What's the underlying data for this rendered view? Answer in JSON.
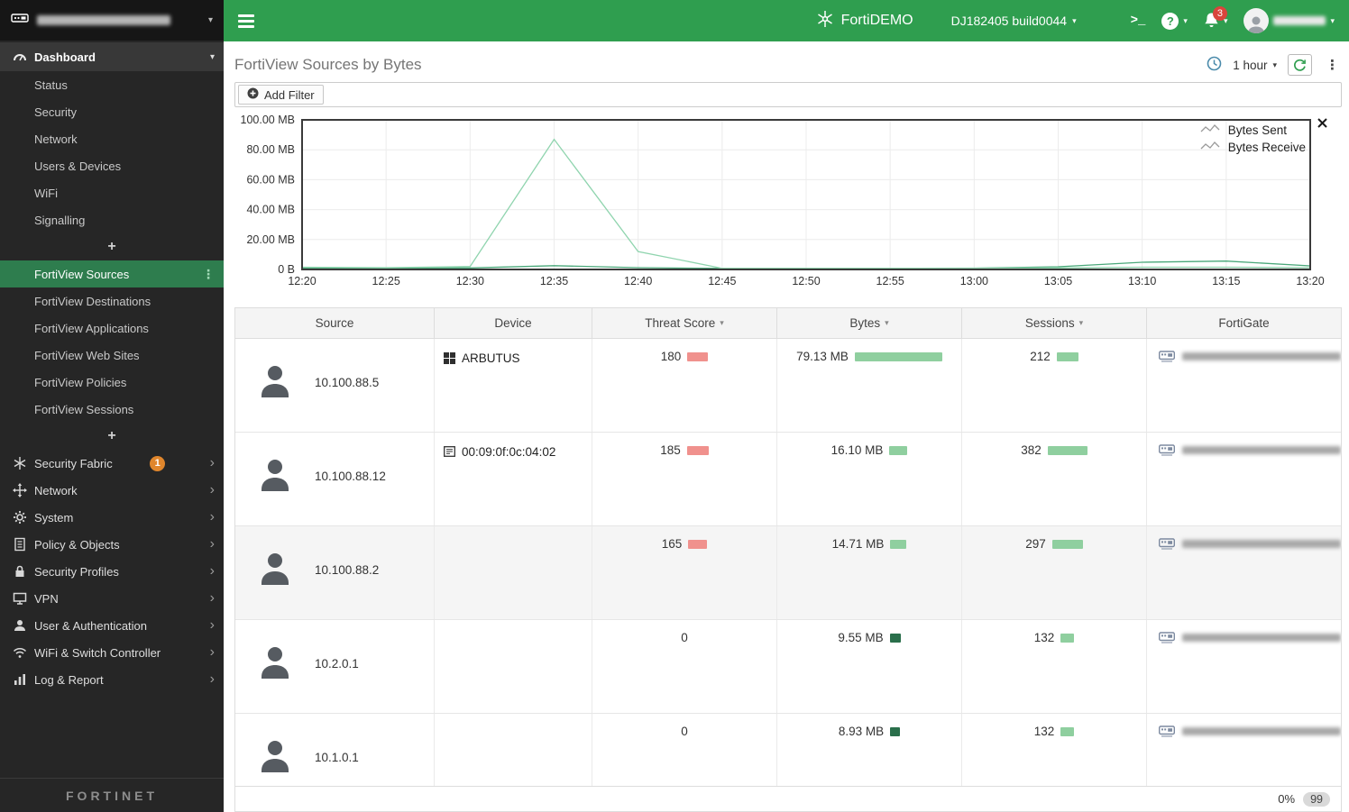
{
  "topbar": {
    "brand": "FortiDEMO",
    "build_label": "DJ182405 build0044",
    "cli_label": ">_",
    "help_label": "?",
    "notification_count": "3"
  },
  "sidebar": {
    "dashboard": {
      "label": "Dashboard"
    },
    "dashboard_items": [
      "Status",
      "Security",
      "Network",
      "Users & Devices",
      "WiFi",
      "Signalling"
    ],
    "add_button": "+",
    "fortiview_items": [
      {
        "label": "FortiView Sources",
        "selected": true
      },
      {
        "label": "FortiView Destinations"
      },
      {
        "label": "FortiView Applications"
      },
      {
        "label": "FortiView Web Sites"
      },
      {
        "label": "FortiView Policies"
      },
      {
        "label": "FortiView Sessions"
      }
    ],
    "add_button2": "+",
    "groups": [
      {
        "label": "Security Fabric",
        "icon": "fabric-icon",
        "badge": "1"
      },
      {
        "label": "Network",
        "icon": "network-icon"
      },
      {
        "label": "System",
        "icon": "gear-icon"
      },
      {
        "label": "Policy & Objects",
        "icon": "policy-icon"
      },
      {
        "label": "Security Profiles",
        "icon": "lock-icon"
      },
      {
        "label": "VPN",
        "icon": "monitor-icon"
      },
      {
        "label": "User & Authentication",
        "icon": "user-icon"
      },
      {
        "label": "WiFi & Switch Controller",
        "icon": "wifi-icon"
      },
      {
        "label": "Log & Report",
        "icon": "report-icon"
      }
    ],
    "logo_text": "FORTINET"
  },
  "main": {
    "title": "FortiView Sources by Bytes",
    "time_range": "1 hour",
    "filter_button": "Add Filter",
    "footer": {
      "percent": "0%",
      "count": "99"
    }
  },
  "chart_data": {
    "type": "line",
    "title": "",
    "xlabel": "",
    "ylabel": "",
    "ylim": [
      0,
      100
    ],
    "grid": true,
    "legend_position": "top-right",
    "yticks": [
      {
        "v": 100,
        "label": "100.00 MB"
      },
      {
        "v": 80,
        "label": "80.00 MB"
      },
      {
        "v": 60,
        "label": "60.00 MB"
      },
      {
        "v": 40,
        "label": "40.00 MB"
      },
      {
        "v": 20,
        "label": "20.00 MB"
      },
      {
        "v": 0,
        "label": "0 B"
      }
    ],
    "x": [
      "12:20",
      "12:25",
      "12:30",
      "12:35",
      "12:40",
      "12:45",
      "12:50",
      "12:55",
      "13:00",
      "13:05",
      "13:10",
      "13:15",
      "13:20"
    ],
    "series": [
      {
        "name": "Bytes Sent",
        "color": "#8fd4ae",
        "values": [
          1.5,
          1.2,
          2.0,
          87.0,
          12.0,
          0.8,
          0.8,
          0.8,
          0.8,
          1.0,
          1.5,
          1.5,
          1.2
        ]
      },
      {
        "name": "Bytes Receive",
        "color": "#4aa87a",
        "values": [
          1.0,
          0.9,
          1.0,
          2.5,
          1.2,
          0.7,
          0.7,
          0.7,
          0.9,
          1.8,
          4.8,
          5.6,
          2.4
        ]
      }
    ]
  },
  "table": {
    "columns": [
      {
        "label": "Source",
        "sortable": false
      },
      {
        "label": "Device",
        "sortable": false
      },
      {
        "label": "Threat Score",
        "sortable": true
      },
      {
        "label": "Bytes",
        "sortable": true
      },
      {
        "label": "Sessions",
        "sortable": true
      },
      {
        "label": "FortiGate",
        "sortable": false
      }
    ],
    "rows": [
      {
        "source": "10.100.88.5",
        "device": "ARBUTUS",
        "device_icon": "windows",
        "threat_score": 180,
        "bytes_label": "79.13 MB",
        "bytes_mb": 79.13,
        "sessions": 212,
        "bytes_bar": "light"
      },
      {
        "source": "10.100.88.12",
        "device": "00:09:0f:0c:04:02",
        "device_icon": "device",
        "threat_score": 185,
        "bytes_label": "16.10 MB",
        "bytes_mb": 16.1,
        "sessions": 382,
        "bytes_bar": "light"
      },
      {
        "source": "10.100.88.2",
        "device": "",
        "device_icon": "",
        "threat_score": 165,
        "bytes_label": "14.71 MB",
        "bytes_mb": 14.71,
        "sessions": 297,
        "bytes_bar": "light"
      },
      {
        "source": "10.2.0.1",
        "device": "",
        "device_icon": "",
        "threat_score": 0,
        "bytes_label": "9.55 MB",
        "bytes_mb": 9.55,
        "sessions": 132,
        "bytes_bar": "dark"
      },
      {
        "source": "10.1.0.1",
        "device": "",
        "device_icon": "",
        "threat_score": 0,
        "bytes_label": "8.93 MB",
        "bytes_mb": 8.93,
        "sessions": 132,
        "bytes_bar": "dark"
      }
    ]
  }
}
